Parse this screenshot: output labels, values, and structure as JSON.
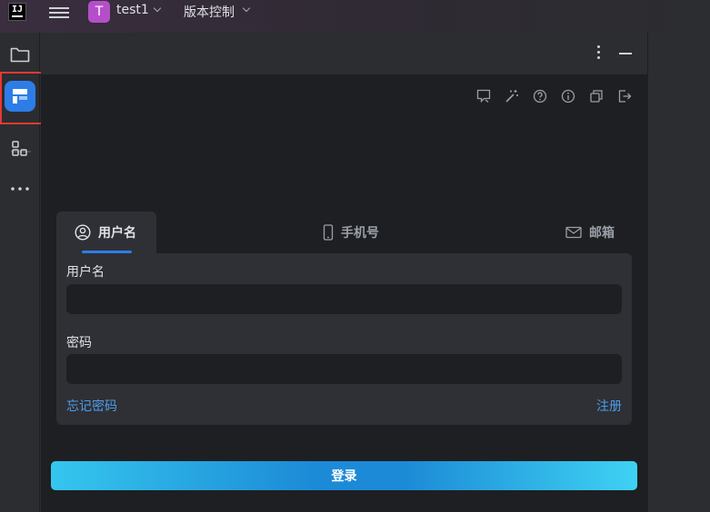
{
  "titlebar": {
    "logo_text": "IJ",
    "project_badge": "T",
    "project_name": "test1",
    "vcs_label": "版本控制",
    "project_badge_color": "#b54fc9"
  },
  "left_stripe": {
    "items": [
      {
        "icon": "folder-icon"
      },
      {
        "icon": "plugin-app-icon",
        "highlighted": true
      },
      {
        "icon": "structure-icon"
      },
      {
        "icon": "more-icon"
      }
    ],
    "highlight_color": "#e53935"
  },
  "tool_window": {
    "header_icons": [
      "kebab-menu-icon",
      "minimize-icon"
    ],
    "toolbar_icons": [
      "feedback-icon",
      "magic-wand-icon",
      "help-icon",
      "info-icon",
      "copy-icon",
      "logout-icon"
    ]
  },
  "login": {
    "tabs": [
      {
        "label": "用户名",
        "icon": "user-icon",
        "active": true
      },
      {
        "label": "手机号",
        "icon": "phone-icon",
        "active": false
      },
      {
        "label": "邮箱",
        "icon": "mail-icon",
        "active": false
      }
    ],
    "username_label": "用户名",
    "username_value": "",
    "password_label": "密码",
    "password_value": "",
    "forgot_link": "忘记密码",
    "register_link": "注册",
    "submit_label": "登录",
    "accent_color": "#2d7de8",
    "link_color": "#4a9eea"
  }
}
